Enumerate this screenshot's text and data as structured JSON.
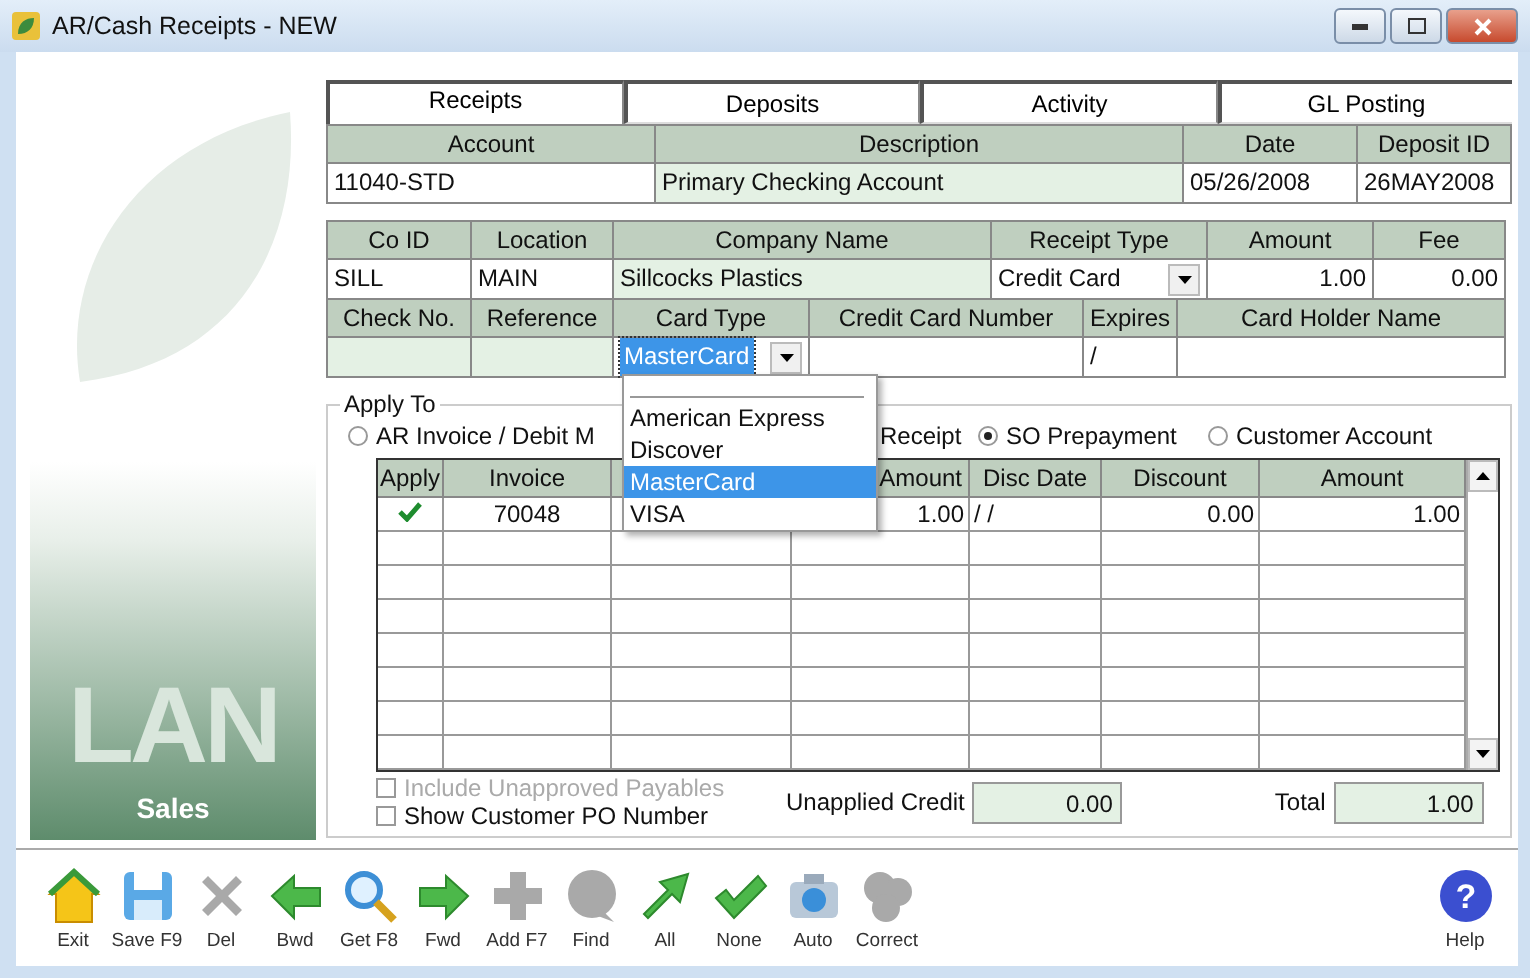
{
  "window": {
    "title": "AR/Cash Receipts - NEW"
  },
  "sidebar": {
    "logo_text": "LAN",
    "module": "Sales"
  },
  "tabs": [
    {
      "label": "Receipts",
      "selected": true
    },
    {
      "label": "Deposits",
      "selected": false
    },
    {
      "label": "Activity",
      "selected": false
    },
    {
      "label": "GL Posting",
      "selected": false
    }
  ],
  "account_grid": {
    "columns": [
      "Account",
      "Description",
      "Date",
      "Deposit ID"
    ],
    "cells": [
      {
        "value": "11040-STD",
        "readonly": false
      },
      {
        "value": "Primary Checking Account",
        "readonly": true
      },
      {
        "value": "05/26/2008",
        "readonly": false
      },
      {
        "value": "26MAY2008",
        "readonly": false
      }
    ]
  },
  "receipt_grid": {
    "columns": [
      "Co ID",
      "Location",
      "Company Name",
      "Receipt Type",
      "Amount",
      "Fee"
    ],
    "cells": [
      {
        "value": "SILL",
        "readonly": false
      },
      {
        "value": "MAIN",
        "readonly": false
      },
      {
        "value": "Sillcocks Plastics",
        "readonly": true
      },
      {
        "value": "Credit Card",
        "readonly": false,
        "kind": "combo"
      },
      {
        "value": "1.00",
        "readonly": false,
        "kind": "number"
      },
      {
        "value": "0.00",
        "readonly": false,
        "kind": "number"
      }
    ]
  },
  "card_grid": {
    "columns": [
      "Check No.",
      "Reference",
      "Card Type",
      "Credit Card Number",
      "Expires",
      "Card Holder Name"
    ],
    "cells": [
      {
        "readonly": true
      },
      {
        "readonly": true
      },
      {
        "value": "MasterCard",
        "readonly": false,
        "kind": "combo",
        "focused": true
      },
      {
        "readonly": false
      },
      {
        "value": "/",
        "readonly": false
      },
      {
        "readonly": false
      }
    ]
  },
  "card_type_dropdown": {
    "options": [
      {
        "label": "American Express",
        "selected": false
      },
      {
        "label": "Discover",
        "selected": false
      },
      {
        "label": "MasterCard",
        "selected": true
      },
      {
        "label": "VISA",
        "selected": false
      }
    ]
  },
  "apply_to": {
    "title": "Apply To",
    "options": [
      {
        "label": "AR Invoice / Debit M",
        "selected": false
      },
      {
        "label": "Receipt"
      },
      {
        "label": "SO Prepayment",
        "selected": true
      },
      {
        "label": "Customer Account",
        "selected": false
      }
    ],
    "table": {
      "columns": [
        {
          "label": "Apply"
        },
        {
          "label": "Invoice"
        },
        {},
        {
          "label": "Amount"
        },
        {
          "label": "Disc Date"
        },
        {
          "label": "Discount"
        },
        {
          "label": "Amount"
        }
      ],
      "rows": [
        {
          "applied": true,
          "invoice": "70048",
          "column_4": "1.00",
          "disc_date": "/ /",
          "discount": "0.00",
          "amount": "1.00"
        }
      ]
    },
    "checkboxes": [
      {
        "label": "Include Unapproved Payables",
        "checked": false,
        "disabled": true
      },
      {
        "label": "Show Customer PO Number",
        "checked": false,
        "disabled": false
      }
    ],
    "unapplied_credit": {
      "label": "Unapplied Credit",
      "value": "0.00"
    },
    "total": {
      "label": "Total",
      "value": "1.00"
    }
  },
  "toolbar": [
    {
      "label": "Exit",
      "disabled": false
    },
    {
      "label": "Save F9",
      "disabled": false
    },
    {
      "label": "Del",
      "disabled": true
    },
    {
      "label": "Bwd",
      "disabled": false
    },
    {
      "label": "Get F8",
      "disabled": false
    },
    {
      "label": "Fwd",
      "disabled": false
    },
    {
      "label": "Add F7",
      "disabled": true
    },
    {
      "label": "Find",
      "disabled": true
    },
    {
      "label": "All",
      "disabled": false
    },
    {
      "label": "None",
      "disabled": false
    },
    {
      "label": "Auto",
      "disabled": false
    },
    {
      "label": "Correct",
      "disabled": true
    }
  ],
  "help": {
    "label": "Help",
    "icon_text": "?"
  }
}
